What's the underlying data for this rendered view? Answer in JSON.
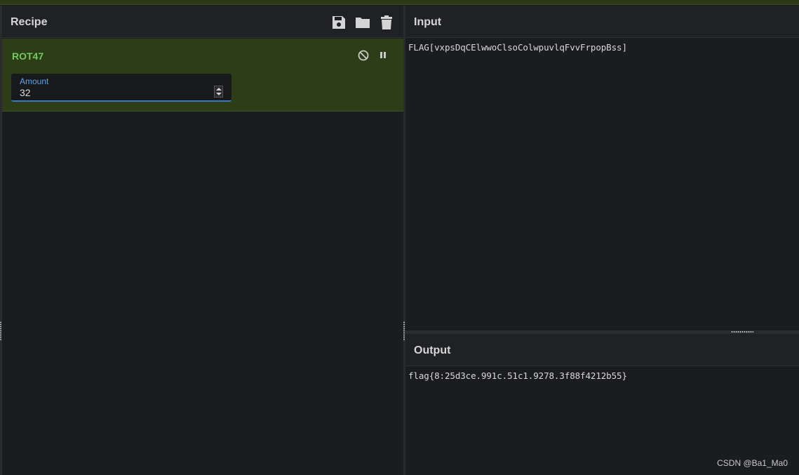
{
  "recipe": {
    "title": "Recipe",
    "icons": [
      "save-icon",
      "folder-icon",
      "trash-icon"
    ],
    "operation": {
      "name": "ROT47",
      "icons": [
        "disable-icon",
        "pause-icon"
      ],
      "argument": {
        "label": "Amount",
        "value": "32"
      }
    }
  },
  "input": {
    "title": "Input",
    "text": "FLAG[vxpsDqCElwwoClsoColwpuvlqFvvFrpopBss]"
  },
  "output": {
    "title": "Output",
    "text": "flag{8:25d3ce.991c.51c1.9278.3f88f4212b55}"
  },
  "watermark": "CSDN @Ba1_Ma0",
  "colors": {
    "background": "#1b1c1f",
    "operation_bg": "#2d3d18",
    "operation_name": "#6fca5f",
    "arg_label": "#5aa6ec",
    "arg_underline": "#3a78c4"
  }
}
